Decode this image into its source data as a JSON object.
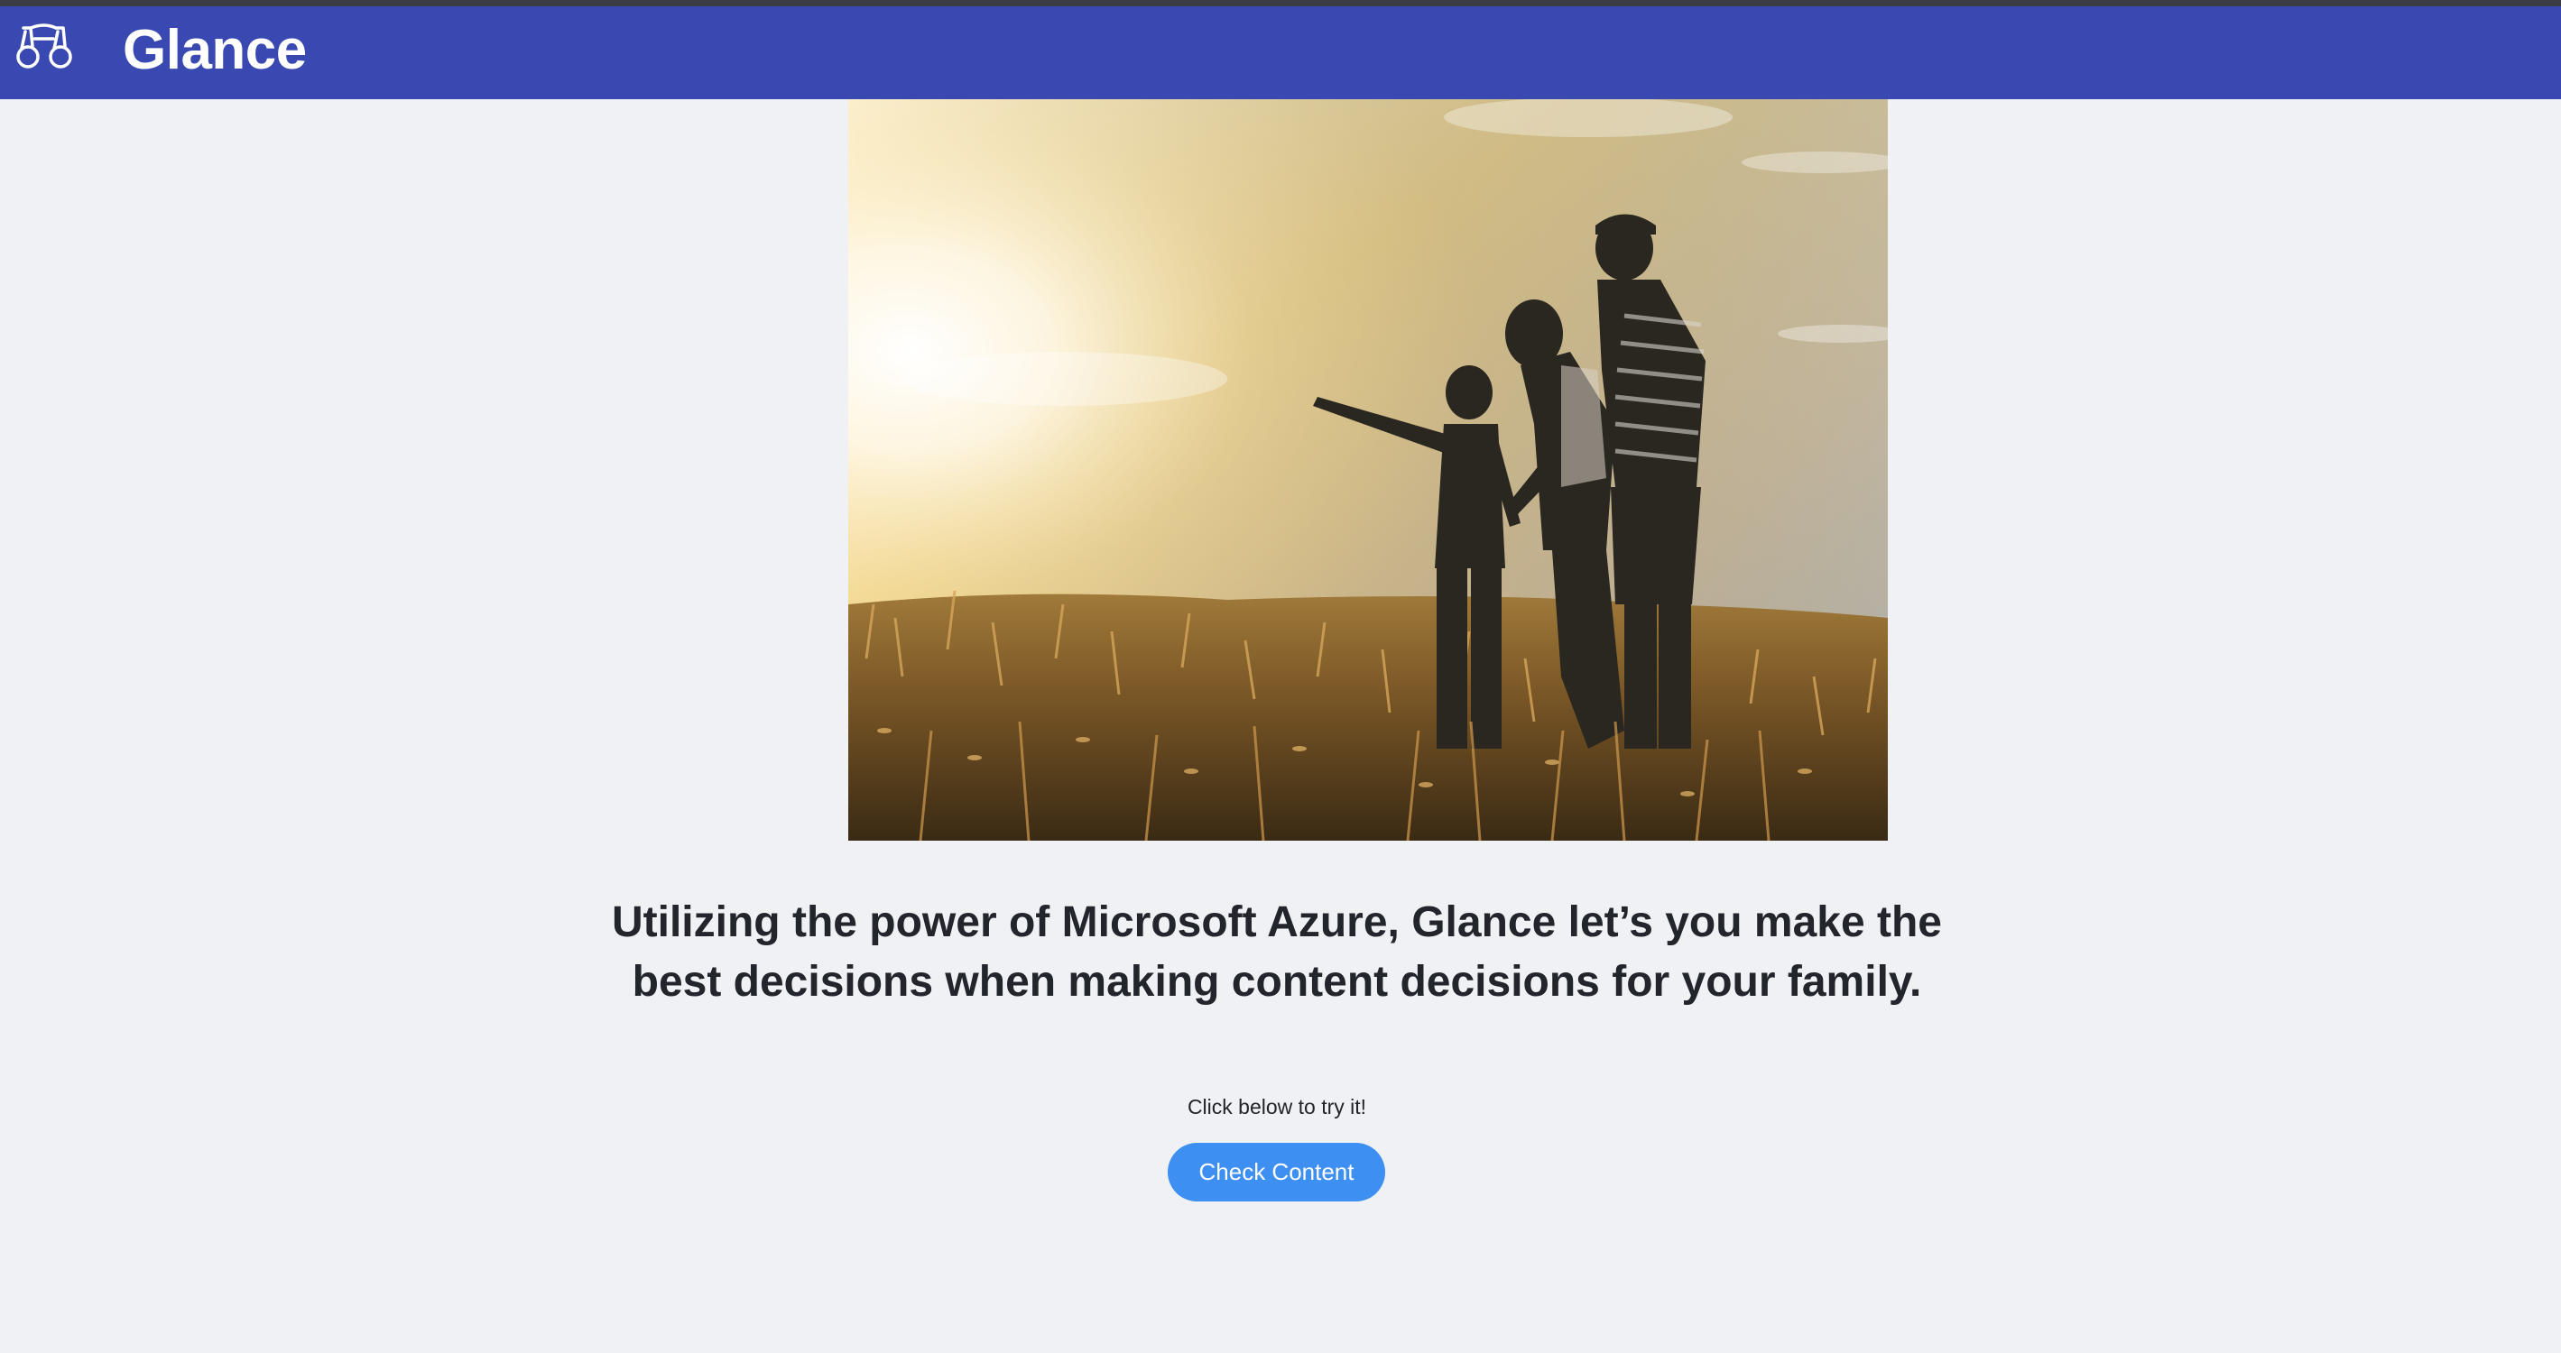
{
  "app": {
    "title": "Glance",
    "logo_icon": "binoculars-icon"
  },
  "colors": {
    "navbar": "#3949b1",
    "page_background": "#f0f1f4",
    "button": "#3d8ff2"
  },
  "hero": {
    "image": "family-silhouette-sunset-field-photo"
  },
  "main": {
    "headline_line1": "Utilizing the power of Microsoft Azure, Glance let’s you make the",
    "headline_line2": "best decisions when making content decisions for your family.",
    "cta_label": "Click below to try it!",
    "cta_button": "Check Content"
  }
}
